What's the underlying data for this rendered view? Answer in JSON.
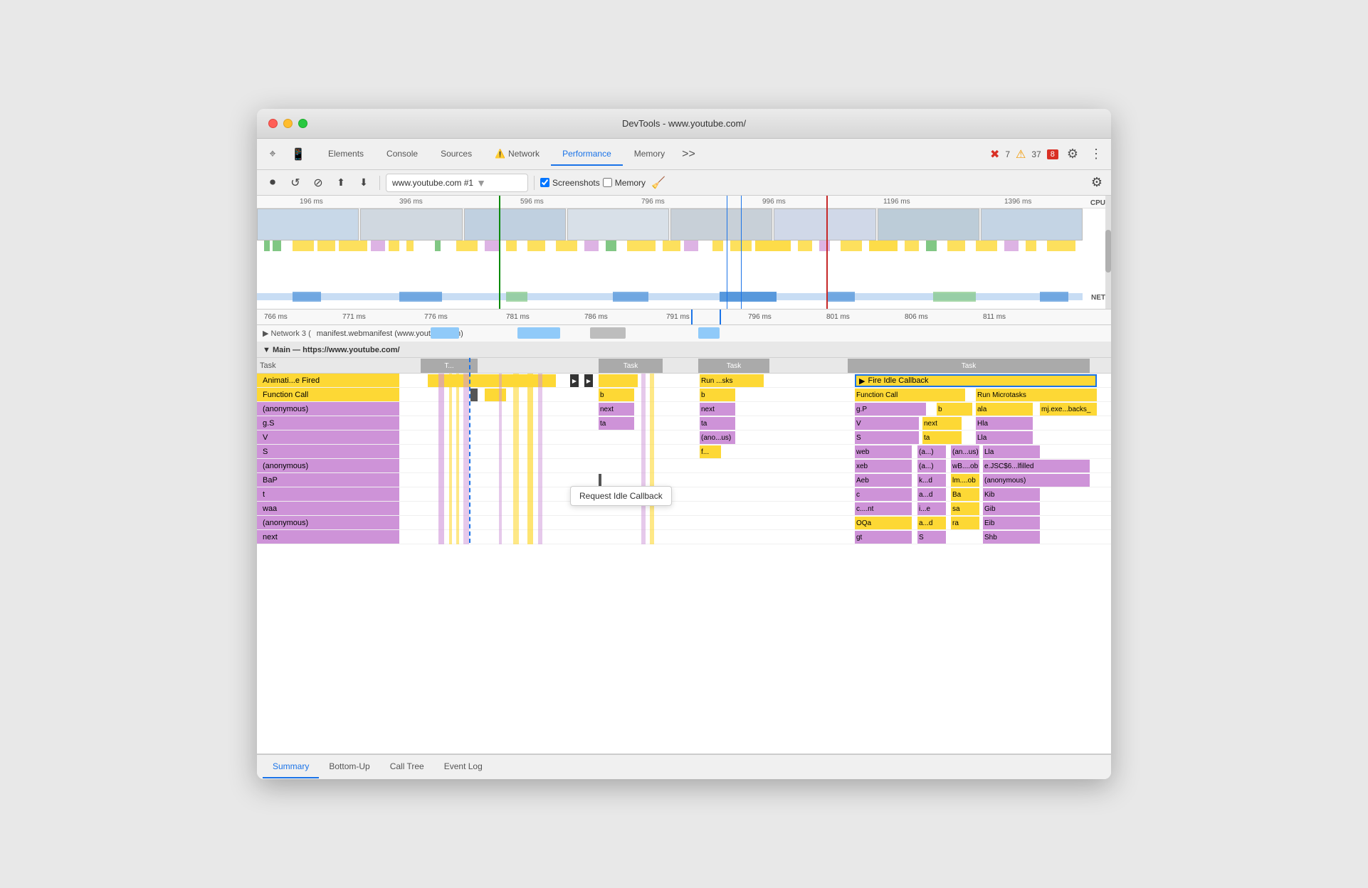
{
  "window": {
    "title": "DevTools - www.youtube.com/"
  },
  "tabs": {
    "items": [
      {
        "label": "Elements",
        "active": false
      },
      {
        "label": "Console",
        "active": false
      },
      {
        "label": "Sources",
        "active": false
      },
      {
        "label": "Network",
        "active": false,
        "hasWarning": true
      },
      {
        "label": "Performance",
        "active": true
      },
      {
        "label": "Memory",
        "active": false
      }
    ],
    "more": ">>",
    "error_count": "7",
    "warn_count": "37",
    "log_count": "8"
  },
  "toolbar": {
    "url": "www.youtube.com #1",
    "screenshots_label": "Screenshots",
    "memory_label": "Memory",
    "screenshots_checked": true,
    "memory_checked": false
  },
  "ruler1": {
    "marks": [
      "196 ms",
      "396 ms",
      "596 ms",
      "796 ms",
      "996 ms",
      "1196 ms",
      "1396 ms"
    ],
    "cpu_label": "CPU",
    "net_label": "NET"
  },
  "ruler2": {
    "marks": [
      "766 ms",
      "771 ms",
      "776 ms",
      "781 ms",
      "786 ms",
      "791 ms",
      "796 ms",
      "801 ms",
      "806 ms",
      "811 ms"
    ]
  },
  "network_row": {
    "label": "▶ Network 3 (",
    "content": "manifest.webmanifest (www.youtube.com)"
  },
  "main_section": {
    "label": "▼ Main — https://www.youtube.com/"
  },
  "flame_rows": [
    {
      "label": "Task",
      "color": "gray"
    },
    {
      "label": "Animati...e Fired",
      "color": "yellow"
    },
    {
      "label": "Function Call",
      "color": "yellow"
    },
    {
      "label": "(anonymous)",
      "color": "purple"
    },
    {
      "label": "g.S",
      "color": "purple"
    },
    {
      "label": "V",
      "color": "purple"
    },
    {
      "label": "S",
      "color": "purple"
    },
    {
      "label": "(anonymous)",
      "color": "purple"
    },
    {
      "label": "BaP",
      "color": "purple"
    },
    {
      "label": "t",
      "color": "purple"
    },
    {
      "label": "waa",
      "color": "purple"
    },
    {
      "label": "(anonymous)",
      "color": "purple"
    },
    {
      "label": "next",
      "color": "purple"
    }
  ],
  "flame_task_cols": {
    "tasks": [
      "T...",
      "Task",
      "Task",
      "Task"
    ]
  },
  "flame_blocks": {
    "run_sks": "Run ...sks",
    "fire_idle": "Fire Idle Callback",
    "function_call": "Function Call",
    "run_micro": "Run Microtasks",
    "b_label": "b",
    "next_label": "next",
    "ta_label": "ta",
    "anous": "(ano...us)",
    "f_label": "f...",
    "gp": "g.P",
    "v": "V",
    "s": "S",
    "web": "web",
    "xeb": "xeb",
    "aeb": "Aeb",
    "c": "c",
    "cnt": "c....nt",
    "oqa": "OQa",
    "gt": "gt",
    "ala": "ala",
    "mj": "mj.exe...backs_",
    "hla": "Hla",
    "lla": "Lla",
    "ejsc": "e.JSC$6...lfilled",
    "anon_block": "(anonymous)",
    "kib": "Kib",
    "gib": "Gib",
    "eib": "Eib",
    "shb": "Shb"
  },
  "tooltip": {
    "text": "Request Idle Callback"
  },
  "bottom_tabs": {
    "items": [
      {
        "label": "Summary",
        "active": true
      },
      {
        "label": "Bottom-Up",
        "active": false
      },
      {
        "label": "Call Tree",
        "active": false
      },
      {
        "label": "Event Log",
        "active": false
      }
    ]
  },
  "icons": {
    "record": "⏺",
    "reload": "↺",
    "clear": "⊘",
    "upload": "↑",
    "download": "↓",
    "gear": "⚙",
    "dots": "⋮",
    "cursor": "⌖",
    "device": "📱",
    "brush": "🧹"
  }
}
